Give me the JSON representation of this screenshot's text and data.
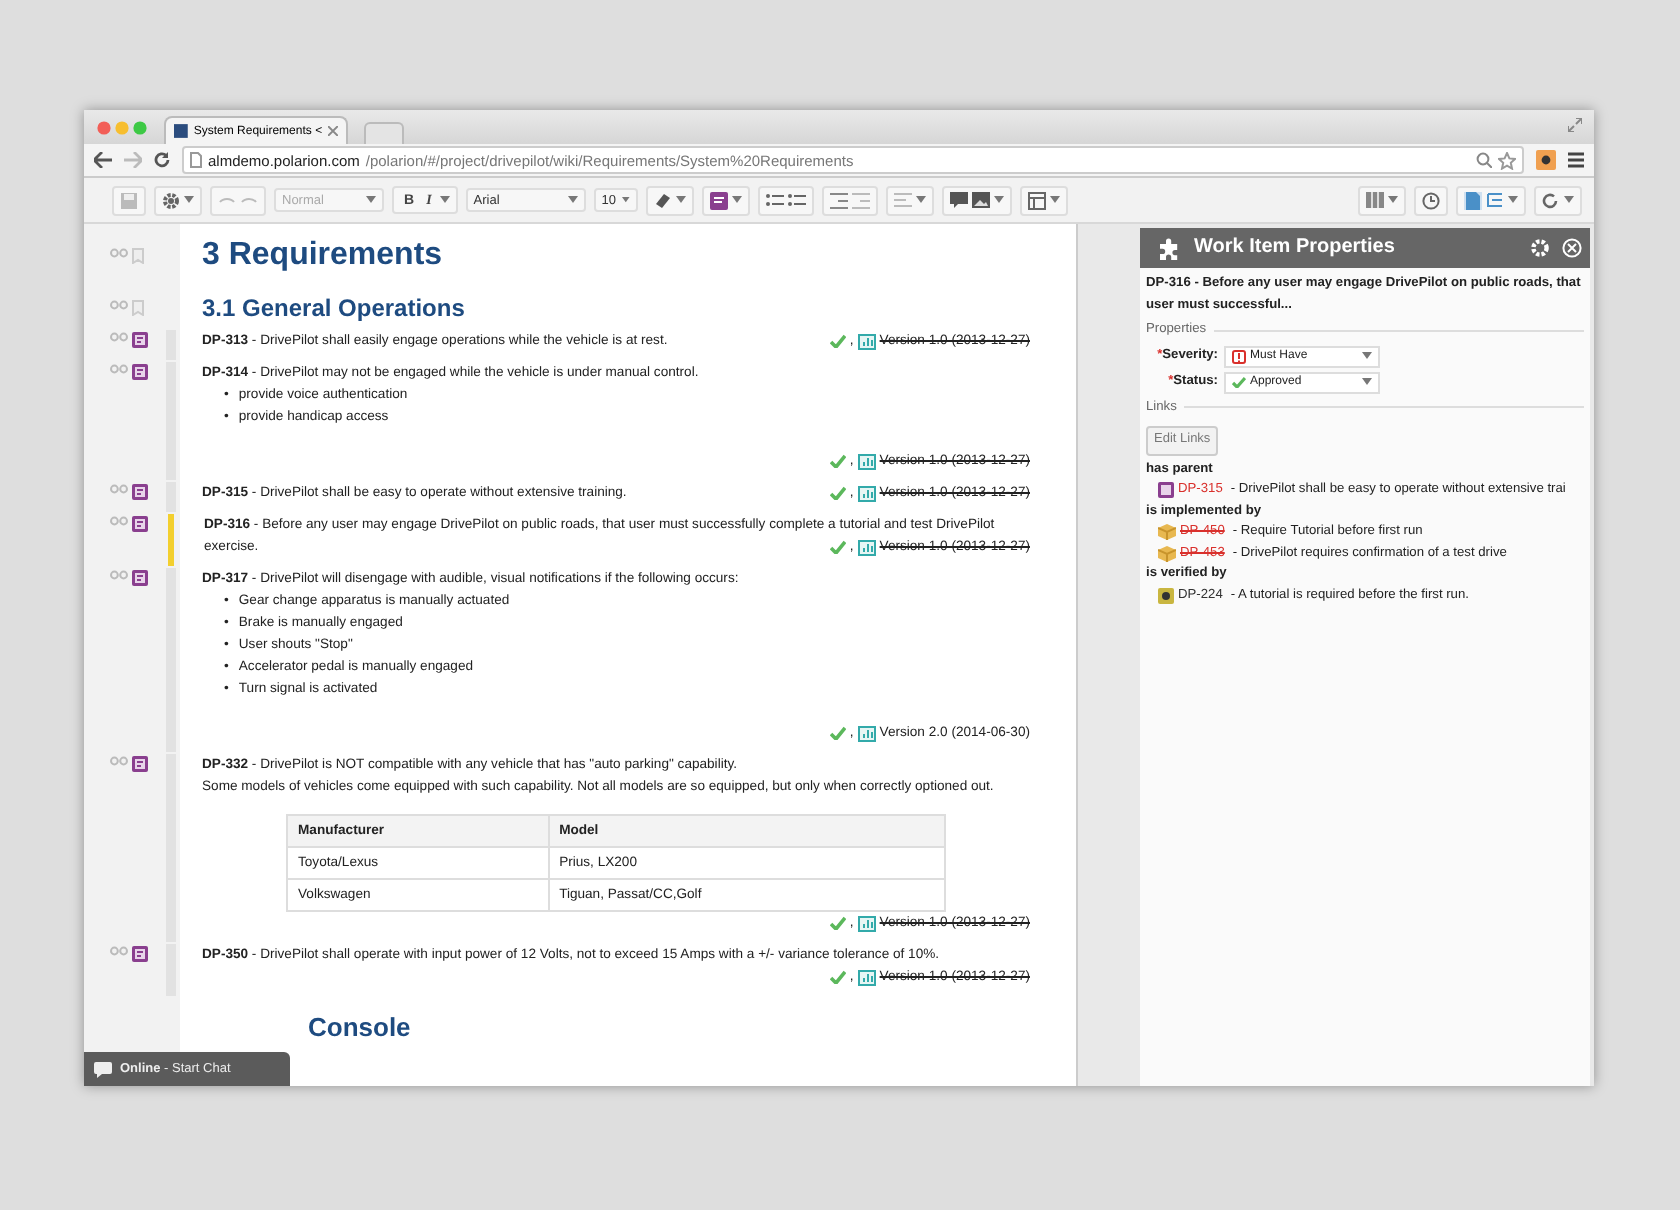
{
  "browser": {
    "tab_title": "System Requirements <",
    "url_host": "almdemo.polarion.com",
    "url_path": "/polarion/#/project/drivepilot/wiki/Requirements/System%20Requirements"
  },
  "toolbar": {
    "style": "Normal",
    "bold": "B",
    "italic": "I",
    "font": "Arial",
    "size": "10"
  },
  "document": {
    "blocks": [
      {
        "kind": "h1",
        "text": "3 Requirements"
      },
      {
        "kind": "h2",
        "text": "3.1 General Operations"
      },
      {
        "kind": "item",
        "text": "**DP-313** - DrivePilot shall easily engage operations while the vehicle is at rest.",
        "selected": false,
        "version": {
          "separator": ",",
          "label": "Version 1.0 (2013-12-27)",
          "obsolete": true
        }
      },
      {
        "kind": "item",
        "text": "**DP-314** - DrivePilot may not be engaged while the vehicle is under manual control.",
        "bullet_marker": "•",
        "bullets": [
          "provide voice authentication",
          "provide handicap access"
        ],
        "selected": false,
        "version": {
          "separator": ",",
          "label": "Version 1.0 (2013-12-27)",
          "obsolete": true
        }
      },
      {
        "kind": "item",
        "text": "**DP-315** - DrivePilot shall be easy to operate without extensive training.",
        "selected": false,
        "version": {
          "separator": ",",
          "label": "Version 1.0 (2013-12-27)",
          "obsolete": true
        }
      },
      {
        "kind": "item",
        "text": "**DP-316** - Before any user may engage DrivePilot on public roads, that user must successfully complete a tutorial and test DrivePilot exercise.",
        "selected": true,
        "version": {
          "separator": ",",
          "label": "Version 1.0 (2013-12-27)",
          "obsolete": true
        }
      },
      {
        "kind": "item",
        "text": "**DP-317** - DrivePilot will disengage with audible, visual notifications if the following occurs:",
        "bullet_marker": "•",
        "bullets": [
          "Gear change apparatus is manually actuated",
          "Brake is manually engaged",
          "User shouts \"Stop\"",
          "Accelerator pedal is manually engaged",
          "Turn signal is activated"
        ],
        "selected": false,
        "version": {
          "separator": ",",
          "label": "Version 2.0 (2014-06-30)",
          "obsolete": false
        }
      },
      {
        "kind": "item",
        "text": "**DP-332** - DrivePilot is NOT compatible with any vehicle that has \"auto parking\" capability.",
        "paragraphs": [
          "Some models of vehicles come equipped with such capability.  Not all models are so equipped, but only when correctly optioned out."
        ],
        "table": {
          "columns": [
            "Manufacturer",
            "Model"
          ],
          "rows": [
            [
              "Toyota/Lexus",
              "Prius, LX200"
            ],
            [
              "Volkswagen",
              "Tiguan, Passat/CC,Golf"
            ]
          ]
        },
        "selected": false,
        "version": {
          "separator": ",",
          "label": "Version 1.0 (2013-12-27)",
          "obsolete": true
        }
      },
      {
        "kind": "item",
        "text": "**DP-350** - DrivePilot shall operate with input power of 12 Volts, not to exceed 15 Amps with a +/- variance tolerance of 10%.",
        "selected": false,
        "version": {
          "separator": ",",
          "label": "Version 1.0 (2013-12-27)",
          "obsolete": true
        }
      },
      {
        "kind": "h2big",
        "text": "Console"
      }
    ]
  },
  "panel": {
    "title": "Work Item Properties",
    "summary": "DP-316 - Before any user may engage DrivePilot on public roads, that user must successful...",
    "properties_label": "Properties",
    "fields": [
      {
        "kind": "severity",
        "required_mark": "*",
        "label": "Severity:",
        "value": "Must Have"
      },
      {
        "kind": "status",
        "required_mark": "*",
        "label": "Status:",
        "value": "Approved"
      }
    ],
    "links_label": "Links",
    "edit_links": "Edit Links",
    "link_groups": [
      {
        "label": "has parent",
        "links": [
          {
            "kind": "requirement",
            "id": "DP-315",
            "text": "- DrivePilot shall be easy to operate without extensive trai",
            "obsolete": false,
            "color": "#d9302c"
          }
        ]
      },
      {
        "label": "is implemented by",
        "links": [
          {
            "kind": "task",
            "id": "DP-450",
            "text": "- Require Tutorial before first run",
            "obsolete": true,
            "color": "#d9302c"
          },
          {
            "kind": "task",
            "id": "DP-453",
            "text": "- DrivePilot requires confirmation of a test drive",
            "obsolete": true,
            "color": "#d9302c"
          }
        ]
      },
      {
        "label": "is verified by",
        "links": [
          {
            "kind": "test",
            "id": "DP-224",
            "text": "- A tutorial  is required before the first run.",
            "obsolete": false,
            "color": "#333333"
          }
        ]
      }
    ]
  },
  "chat": {
    "text": "**Online** - Start Chat"
  }
}
